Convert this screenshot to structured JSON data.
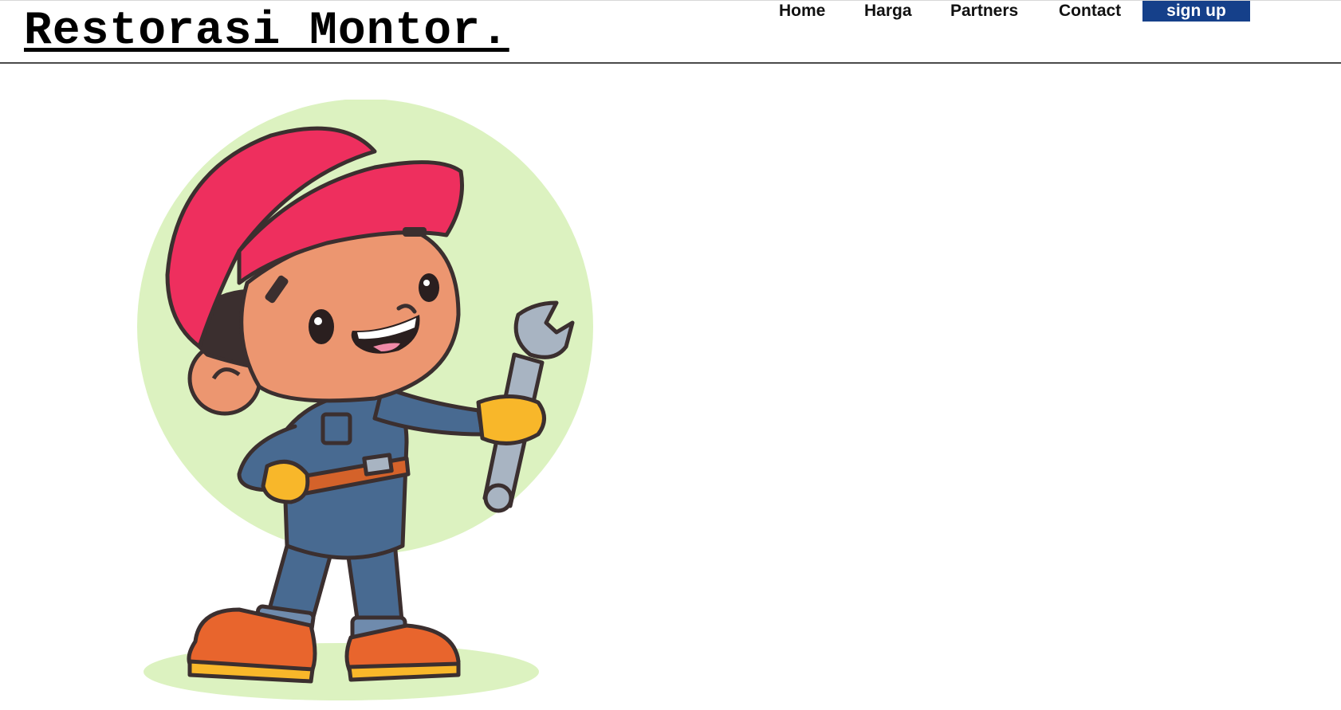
{
  "header": {
    "brand": "Restorasi Montor.",
    "nav": {
      "home": "Home",
      "harga": "Harga",
      "partners": "Partners",
      "contact": "Contact",
      "signup": "sign up"
    }
  },
  "hero": {
    "illustration": "mechanic-cartoon-icon"
  },
  "colors": {
    "signup_bg": "#15408a",
    "circle_bg": "#dcf2c0",
    "cap": "#ee2f5e",
    "skin": "#ec9670",
    "overall": "#486a91",
    "glove": "#f8b72a",
    "boot": "#e8652d",
    "wrench": "#a8b4c2"
  }
}
